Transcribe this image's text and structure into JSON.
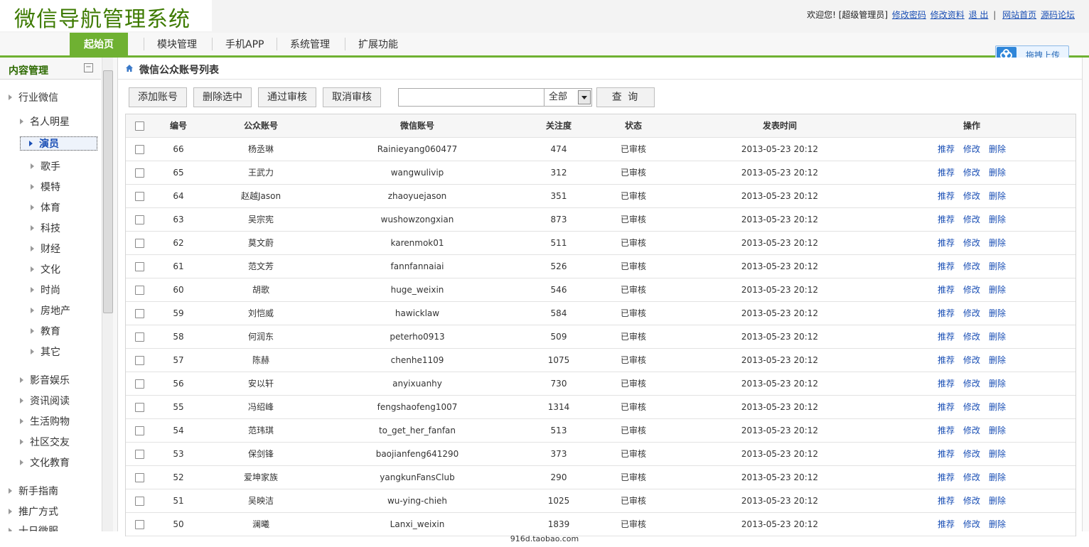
{
  "app": {
    "title": "微信导航管理系统"
  },
  "userbar": {
    "welcome": "欢迎您! [超级管理员]",
    "links": [
      "修改密码",
      "修改资料",
      "退 出"
    ],
    "sep": "|",
    "links2": [
      "网站首页",
      "源码论坛"
    ]
  },
  "nav": {
    "home": "起始页",
    "items": [
      "模块管理",
      "手机APP",
      "系统管理",
      "扩展功能"
    ]
  },
  "upload": {
    "label": "拖拽上传"
  },
  "sidebar": {
    "title": "内容管理",
    "collapse": "−",
    "groups": [
      {
        "label": "行业微信"
      },
      {
        "label": "名人明星"
      },
      {
        "label": "演员",
        "active": true
      },
      {
        "label": "歌手"
      },
      {
        "label": "模特"
      },
      {
        "label": "体育"
      },
      {
        "label": "科技"
      },
      {
        "label": "财经"
      },
      {
        "label": "文化"
      },
      {
        "label": "时尚"
      },
      {
        "label": "房地产"
      },
      {
        "label": "教育"
      },
      {
        "label": "其它"
      },
      {
        "label": "影音娱乐"
      },
      {
        "label": "资讯阅读"
      },
      {
        "label": "生活购物"
      },
      {
        "label": "社区交友"
      },
      {
        "label": "文化教育"
      },
      {
        "label": "新手指南"
      },
      {
        "label": "推广方式"
      },
      {
        "label": "十日微服"
      }
    ]
  },
  "main": {
    "breadcrumb": "微信公众账号列表",
    "toolbar": {
      "add": "添加账号",
      "delete_selected": "删除选中",
      "approve": "通过审核",
      "unapprove": "取消审核",
      "search_value": "",
      "select_value": "全部",
      "query": "查 询"
    },
    "table": {
      "columns": [
        "编号",
        "公众账号",
        "微信账号",
        "关注度",
        "状态",
        "发表时间",
        "操作"
      ],
      "ops": [
        "推荐",
        "修改",
        "删除"
      ],
      "rows": [
        [
          "66",
          "杨丞琳",
          "Rainieyang060477",
          "474",
          "已审核",
          "2013-05-23 20:12"
        ],
        [
          "65",
          "王武力",
          "wangwulivip",
          "312",
          "已审核",
          "2013-05-23 20:12"
        ],
        [
          "64",
          "赵越Jason",
          "zhaoyuejason",
          "351",
          "已审核",
          "2013-05-23 20:12"
        ],
        [
          "63",
          "吴宗宪",
          "wushowzongxian",
          "873",
          "已审核",
          "2013-05-23 20:12"
        ],
        [
          "62",
          "莫文蔚",
          "karenmok01",
          "511",
          "已审核",
          "2013-05-23 20:12"
        ],
        [
          "61",
          "范文芳",
          "fannfannaiai",
          "526",
          "已审核",
          "2013-05-23 20:12"
        ],
        [
          "60",
          "胡歌",
          "huge_weixin",
          "546",
          "已审核",
          "2013-05-23 20:12"
        ],
        [
          "59",
          "刘恺威",
          "hawicklaw",
          "584",
          "已审核",
          "2013-05-23 20:12"
        ],
        [
          "58",
          "何润东",
          "peterho0913",
          "509",
          "已审核",
          "2013-05-23 20:12"
        ],
        [
          "57",
          "陈赫",
          "chenhe1109",
          "1075",
          "已审核",
          "2013-05-23 20:12"
        ],
        [
          "56",
          "安以轩",
          "anyixuanhy",
          "730",
          "已审核",
          "2013-05-23 20:12"
        ],
        [
          "55",
          "冯绍峰",
          "fengshaofeng1007",
          "1314",
          "已审核",
          "2013-05-23 20:12"
        ],
        [
          "54",
          "范玮琪",
          "to_get_her_fanfan",
          "513",
          "已审核",
          "2013-05-23 20:12"
        ],
        [
          "53",
          "保剑锋",
          "baojianfeng641290",
          "373",
          "已审核",
          "2013-05-23 20:12"
        ],
        [
          "52",
          "爱坤家族",
          "yangkunFansClub",
          "290",
          "已审核",
          "2013-05-23 20:12"
        ],
        [
          "51",
          "吴映洁",
          "wu-ying-chieh",
          "1025",
          "已审核",
          "2013-05-23 20:12"
        ],
        [
          "50",
          "澜曦",
          "Lanxi_weixin",
          "1839",
          "已审核",
          "2013-05-23 20:12"
        ]
      ]
    }
  },
  "footer": {
    "text": "916d.taobao.com"
  },
  "colors": {
    "brand_green": "#6fb132",
    "logo_green": "#3d7a00",
    "link_blue": "#1a4fb5"
  }
}
